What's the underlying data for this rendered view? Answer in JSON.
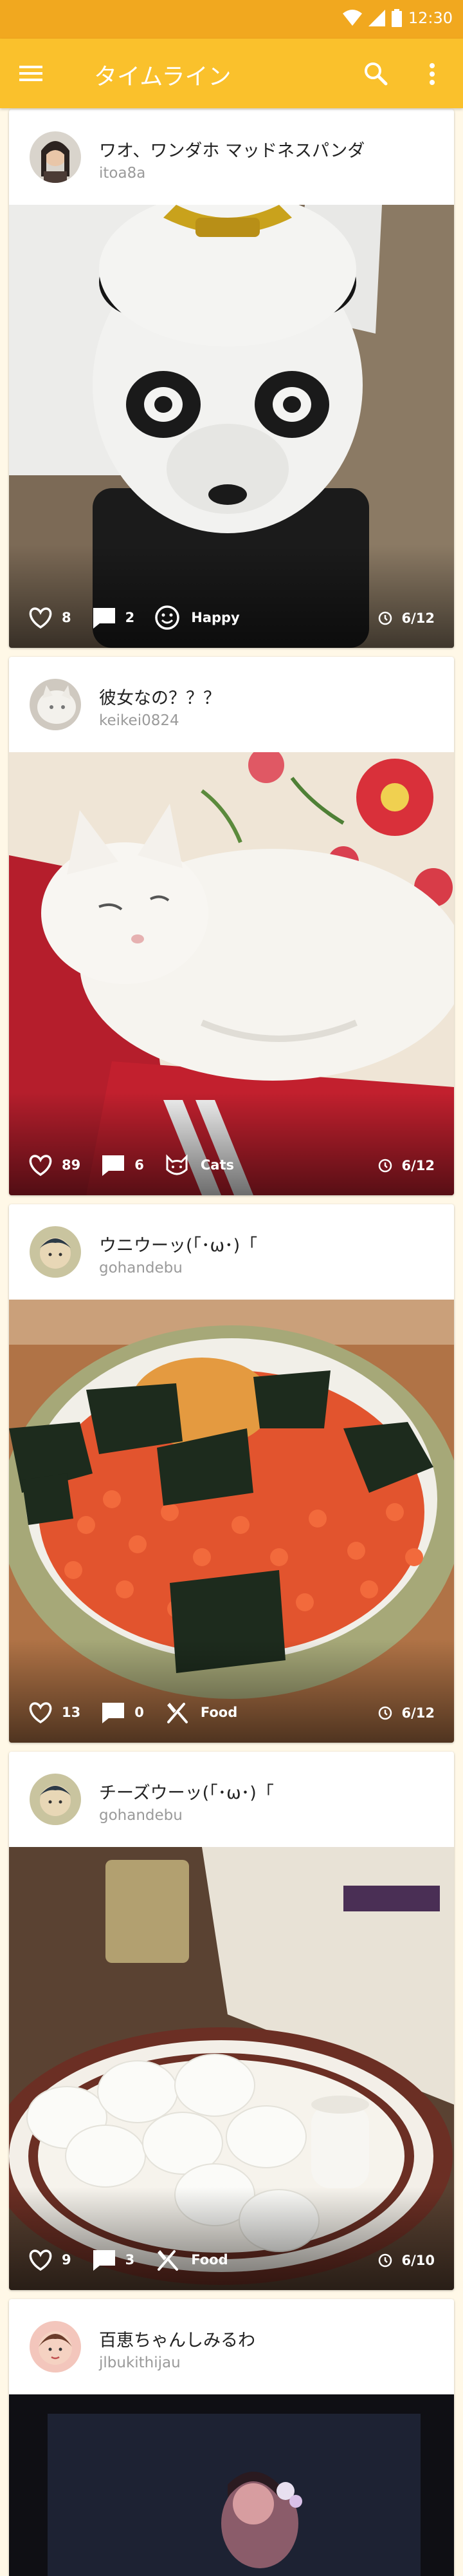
{
  "status_bar": {
    "time": "12:30"
  },
  "app_bar": {
    "title": "タイムライン",
    "icons": [
      "menu-icon",
      "search-icon",
      "more-vert-icon"
    ],
    "color": "#FAC12C"
  },
  "colors": {
    "status_bar": "#F1A81F",
    "app_bar": "#FAC12C",
    "background": "#FFF8E7"
  },
  "posts": [
    {
      "name": "ワオ、ワンダホ マッドネスパンダ",
      "handle": "itoa8a",
      "likes": "8",
      "comments": "2",
      "category": "Happy",
      "category_icon": "smiley-icon",
      "date": "6/12",
      "image": "panda statue"
    },
    {
      "name": "彼女なの？？？",
      "handle": "keikei0824",
      "likes": "89",
      "comments": "6",
      "category": "Cats",
      "category_icon": "cat-icon",
      "date": "6/12",
      "image": "white cat"
    },
    {
      "name": "ウニウーッ(「･ω･)「",
      "handle": "gohandebu",
      "likes": "13",
      "comments": "0",
      "category": "Food",
      "category_icon": "utensils-icon",
      "date": "6/12",
      "image": "uni ikura bowl"
    },
    {
      "name": "チーズウーッ(「･ω･)「",
      "handle": "gohandebu",
      "likes": "9",
      "comments": "3",
      "category": "Food",
      "category_icon": "utensils-icon",
      "date": "6/10",
      "image": "mozzarella plate"
    },
    {
      "name": "百恵ちゃんしみるわ",
      "handle": "jlbukithijau",
      "image": "tv screen"
    }
  ]
}
